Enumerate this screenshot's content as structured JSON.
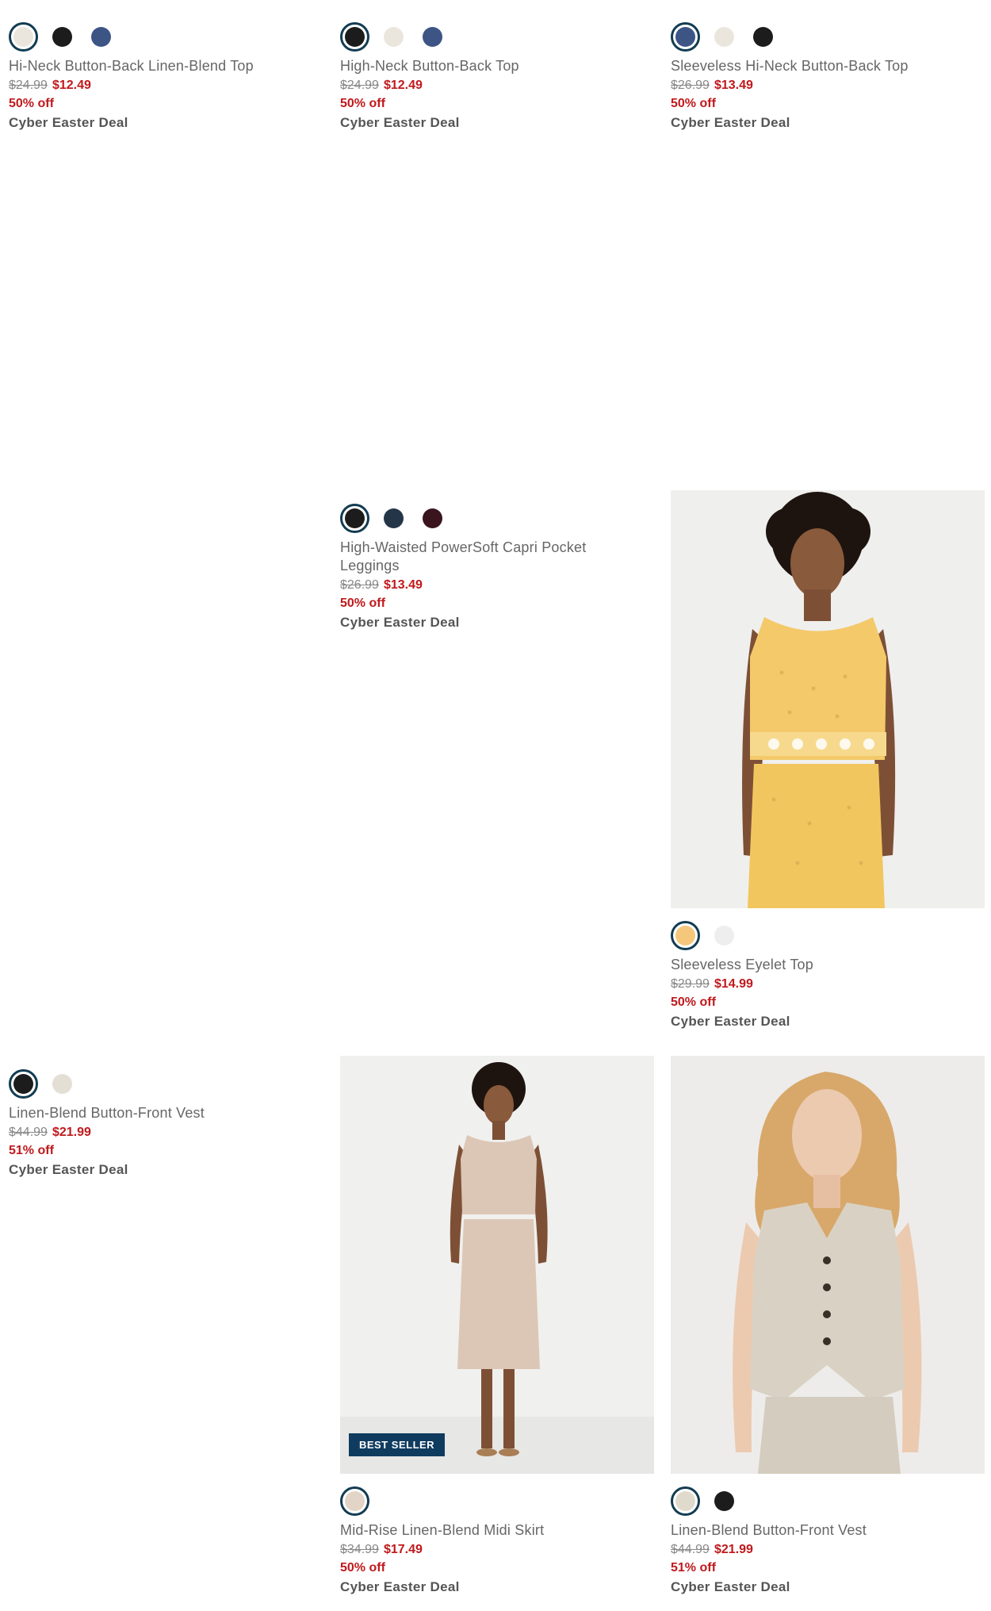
{
  "products": [
    {
      "name": "Hi-Neck Button-Back Linen-Blend Top",
      "original_price": "$24.99",
      "sale_price": "$12.49",
      "discount": "50% off",
      "deal": "Cyber Easter Deal",
      "swatches": [
        "#ebe6dd",
        "#1c1c1c",
        "#3c5585"
      ],
      "selected_swatch": 0
    },
    {
      "name": "High-Neck Button-Back Top",
      "original_price": "$24.99",
      "sale_price": "$12.49",
      "discount": "50% off",
      "deal": "Cyber Easter Deal",
      "swatches": [
        "#1c1c1c",
        "#ebe6dd",
        "#3c5585"
      ],
      "selected_swatch": 0
    },
    {
      "name": "Sleeveless Hi-Neck Button-Back Top",
      "original_price": "$26.99",
      "sale_price": "$13.49",
      "discount": "50% off",
      "deal": "Cyber Easter Deal",
      "swatches": [
        "#3c5585",
        "#ebe6dd",
        "#1c1c1c"
      ],
      "selected_swatch": 0
    },
    {
      "name": "High-Waisted PowerSoft Capri Pocket Leggings",
      "original_price": "$26.99",
      "sale_price": "$13.49",
      "discount": "50% off",
      "deal": "Cyber Easter Deal",
      "swatches": [
        "#1c1c1c",
        "#243548",
        "#3a141e"
      ],
      "selected_swatch": 0
    },
    {
      "name": "Sleeveless Eyelet Top",
      "original_price": "$29.99",
      "sale_price": "$14.99",
      "discount": "50% off",
      "deal": "Cyber Easter Deal",
      "swatches": [
        "#f4c77b",
        "#eeeeee"
      ],
      "selected_swatch": 0
    },
    {
      "name": "Linen-Blend Button-Front Vest",
      "original_price": "$44.99",
      "sale_price": "$21.99",
      "discount": "51% off",
      "deal": "Cyber Easter Deal",
      "swatches": [
        "#1c1c1c",
        "#e3dfd5"
      ],
      "selected_swatch": 0
    },
    {
      "name": "Mid-Rise Linen-Blend Midi Skirt",
      "original_price": "$34.99",
      "sale_price": "$17.49",
      "discount": "50% off",
      "deal": "Cyber Easter Deal",
      "badge": "BEST SELLER",
      "swatches": [
        "#e2d4c6"
      ],
      "selected_swatch": 0
    },
    {
      "name": "Linen-Blend Button-Front Vest",
      "original_price": "$44.99",
      "sale_price": "$21.99",
      "discount": "51% off",
      "deal": "Cyber Easter Deal",
      "swatches": [
        "#e0dacd",
        "#1c1c1c"
      ],
      "selected_swatch": 0
    }
  ]
}
